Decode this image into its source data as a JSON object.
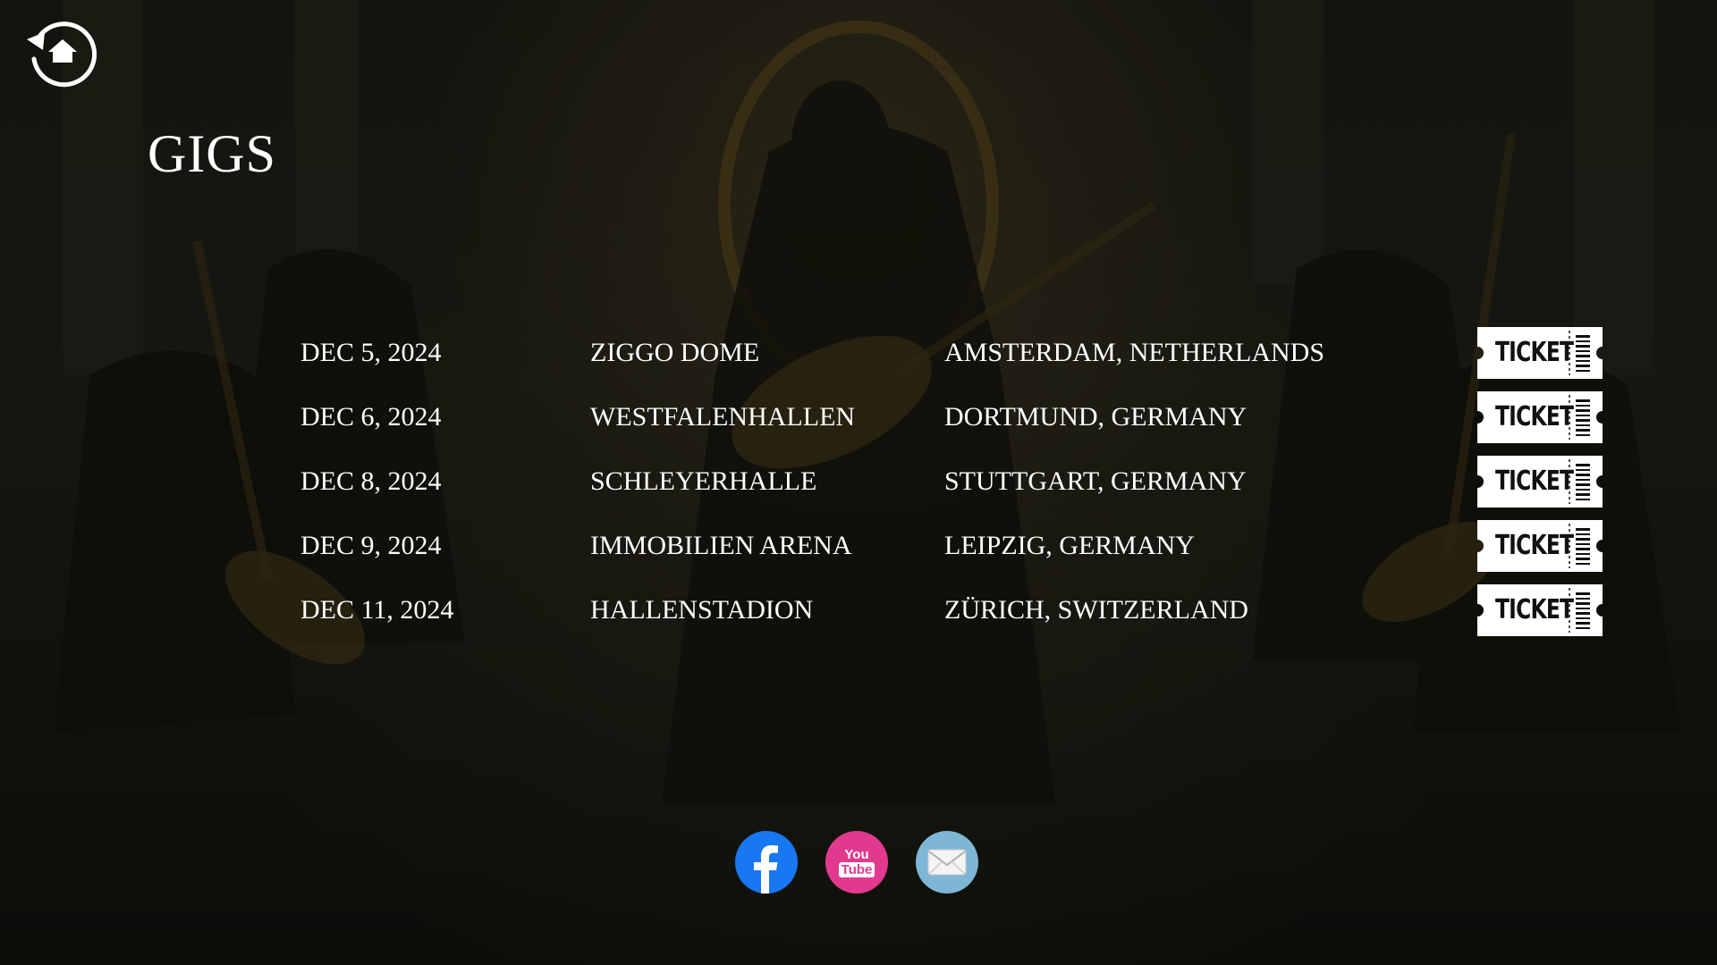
{
  "page": {
    "title": "GIGS",
    "home_icon": "home-refresh-icon"
  },
  "gigs": [
    {
      "date": "DEC 5, 2024",
      "venue": "ZIGGO DOME",
      "city": "AMSTERDAM, NETHERLANDS",
      "ticket_label": "TICKET"
    },
    {
      "date": "DEC 6, 2024",
      "venue": "WESTFALENHALLEN",
      "city": "DORTMUND, GERMANY",
      "ticket_label": "TICKET"
    },
    {
      "date": "DEC 8, 2024",
      "venue": "SCHLEYERHALLE",
      "city": "STUTTGART, GERMANY",
      "ticket_label": "TICKET"
    },
    {
      "date": "DEC 9, 2024",
      "venue": "IMMOBILIEN ARENA",
      "city": "LEIPZIG, GERMANY",
      "ticket_label": "TICKET"
    },
    {
      "date": "DEC 11, 2024",
      "venue": "HALLENSTADION",
      "city": "ZÜRICH, SWITZERLAND",
      "ticket_label": "TICKET"
    }
  ],
  "social": {
    "facebook_icon": "facebook-icon",
    "youtube_icon": "youtube-icon",
    "youtube_you": "You",
    "youtube_tube": "Tube",
    "email_icon": "email-icon",
    "colors": {
      "facebook": "#1877f2",
      "youtube": "#e0398e",
      "email": "#7eb6d6"
    }
  }
}
